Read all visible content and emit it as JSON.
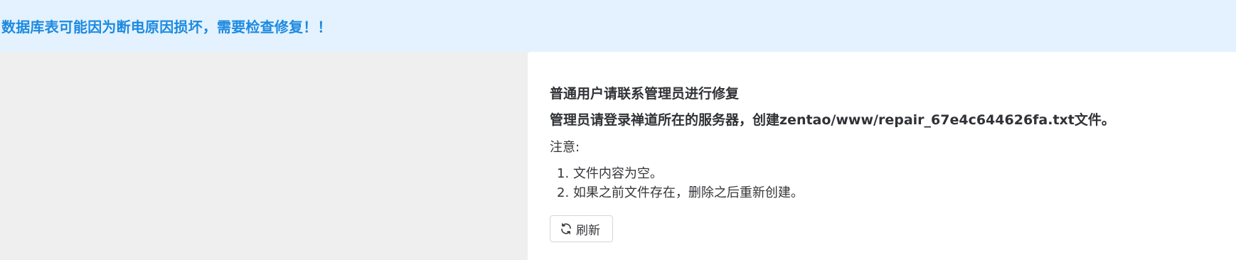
{
  "alert": {
    "message": "数据库表可能因为断电原因损坏，需要检查修复！！"
  },
  "panel": {
    "heading_user": "普通用户请联系管理员进行修复",
    "heading_admin": "管理员请登录禅道所在的服务器，创建zentao/www/repair_67e4c644626fa.txt文件。",
    "note_label": "注意:",
    "notes": [
      "1. 文件内容为空。",
      "2. 如果之前文件存在，删除之后重新创建。"
    ],
    "refresh_label": "刷新",
    "refresh_icon": "refresh-icon"
  },
  "colors": {
    "alert_background": "#e3f2fe",
    "alert_text": "#1d8ae0",
    "page_background": "#efefef",
    "panel_background": "#ffffff"
  }
}
